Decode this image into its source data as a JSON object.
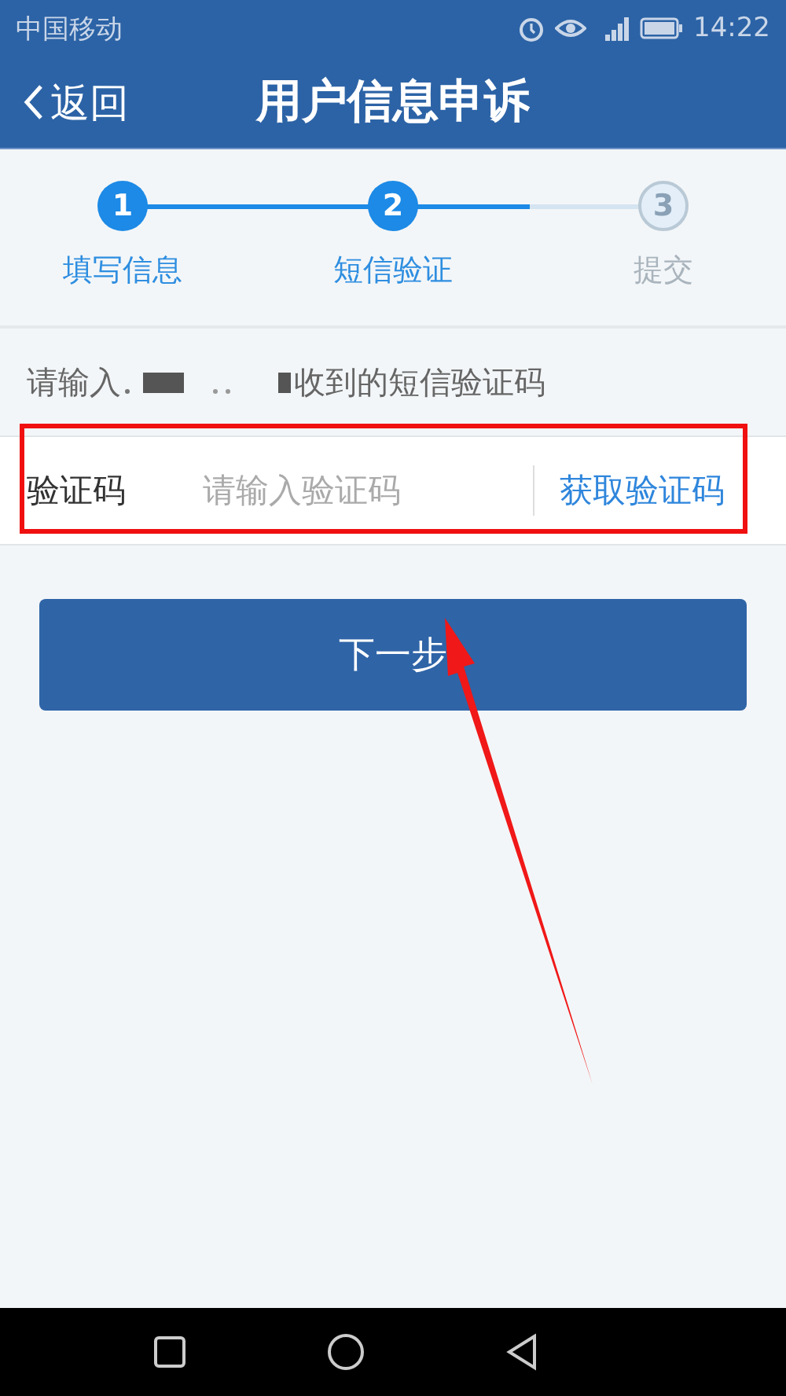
{
  "status_bar": {
    "carrier": "中国移动",
    "time": "14:22"
  },
  "nav": {
    "back": "返回",
    "title": "用户信息申诉"
  },
  "steps": [
    {
      "number": "1",
      "label": "填写信息",
      "done": true
    },
    {
      "number": "2",
      "label": "短信验证",
      "done": true
    },
    {
      "number": "3",
      "label": "提交",
      "done": false
    }
  ],
  "hint": {
    "prefix": "请输入",
    "suffix": "收到的短信验证码"
  },
  "code_field": {
    "label": "验证码",
    "placeholder": "请输入验证码",
    "action": "获取验证码"
  },
  "next_button": "下一步"
}
